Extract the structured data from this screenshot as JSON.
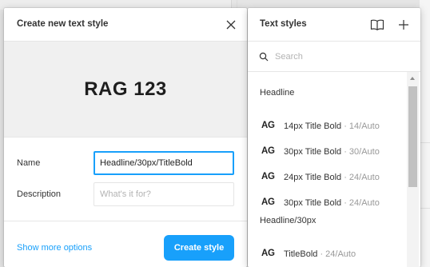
{
  "create_dialog": {
    "title": "Create new text style",
    "preview_text": "RAG 123",
    "name_label": "Name",
    "name_value": "Headline/30px/TitleBold",
    "description_label": "Description",
    "description_placeholder": "What's it for?",
    "more_options_label": "Show more options",
    "create_button_label": "Create style",
    "accent_color": "#18a0fb"
  },
  "text_styles_panel": {
    "title": "Text styles",
    "search_placeholder": "Search",
    "groups": [
      {
        "name": "Headline",
        "items": [
          {
            "icon": "AG",
            "name": "14px Title Bold",
            "meta": " · 14/Auto"
          },
          {
            "icon": "AG",
            "name": "30px Title Bold",
            "meta": " · 30/Auto"
          },
          {
            "icon": "AG",
            "name": "24px Title Bold",
            "meta": " · 24/Auto"
          },
          {
            "icon": "AG",
            "name": "30px Title Bold",
            "meta": " · 24/Auto"
          }
        ]
      },
      {
        "name": "Headline/30px",
        "items": [
          {
            "icon": "AG",
            "name": "TitleBold",
            "meta": " · 24/Auto"
          }
        ]
      }
    ]
  }
}
